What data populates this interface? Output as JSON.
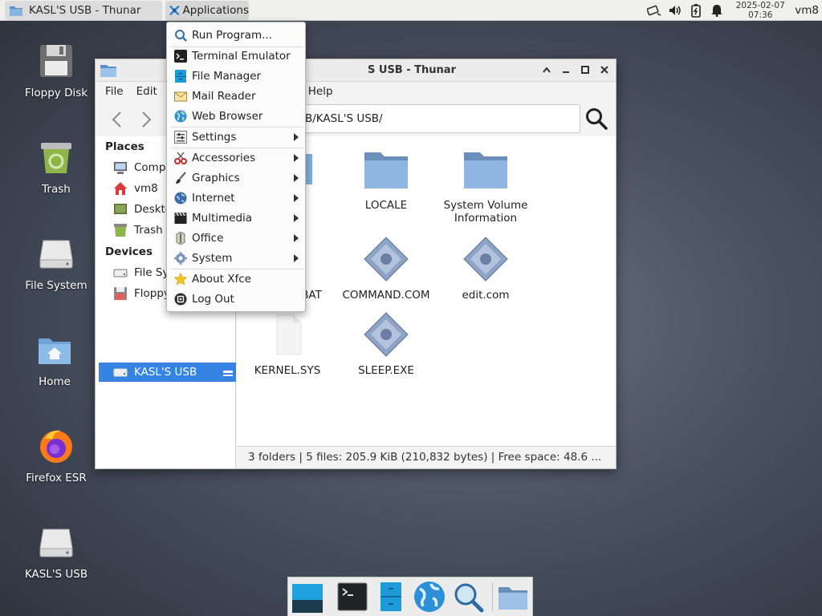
{
  "top_panel": {
    "task_title": "KASL'S USB - Thunar",
    "applications_label": "Applications",
    "clock_date": "2025-02-07",
    "clock_time": "07:36",
    "user": "vm8",
    "tray_icons": [
      "network-icon",
      "volume-icon",
      "battery-icon",
      "notification-bell-icon"
    ]
  },
  "desktop": {
    "icons": [
      {
        "label": "Floppy Disk",
        "icon": "floppy-disk-icon"
      },
      {
        "label": "Trash",
        "icon": "trash-icon"
      },
      {
        "label": "File System",
        "icon": "drive-icon"
      },
      {
        "label": "Home",
        "icon": "home-folder-icon"
      },
      {
        "label": "Firefox ESR",
        "icon": "firefox-icon"
      },
      {
        "label": "KASL'S USB",
        "icon": "usb-drive-icon"
      }
    ]
  },
  "window": {
    "title": "KASL'S USB - Thunar",
    "title_visible": "S USB - Thunar",
    "menu": [
      "File",
      "Edit",
      "Help"
    ],
    "path": "B/KASL'S USB/",
    "sidebar": {
      "places_header": "Places",
      "places": [
        "Compu",
        "vm8",
        "Deskto",
        "Trash"
      ],
      "devices_header": "Devices",
      "devices": [
        "File Sy",
        "Floppy",
        "KASL'S USB"
      ]
    },
    "files": [
      {
        "name": "LOCALE",
        "type": "folder"
      },
      {
        "name": "System Volume Information",
        "type": "folder"
      },
      {
        "name": "BAT",
        "type": "script"
      },
      {
        "name": "COMMAND.COM",
        "type": "executable"
      },
      {
        "name": "edit.com",
        "type": "executable"
      },
      {
        "name": "KERNEL.SYS",
        "type": "document"
      },
      {
        "name": "SLEEP.EXE",
        "type": "executable"
      }
    ],
    "status": "3 folders  |  5 files: 205.9 KiB (210,832 bytes)  |  Free space: 48.6 ..."
  },
  "app_menu": {
    "items": [
      {
        "label": "Run Program...",
        "icon": "magnifier-icon",
        "submenu": false
      },
      {
        "label": "Terminal Emulator",
        "icon": "terminal-icon",
        "submenu": false
      },
      {
        "label": "File Manager",
        "icon": "file-manager-icon",
        "submenu": false
      },
      {
        "label": "Mail Reader",
        "icon": "mail-icon",
        "submenu": false
      },
      {
        "label": "Web Browser",
        "icon": "globe-icon",
        "submenu": false
      },
      {
        "label": "Settings",
        "icon": "settings-icon",
        "submenu": true
      },
      {
        "label": "Accessories",
        "icon": "accessories-icon",
        "submenu": true
      },
      {
        "label": "Graphics",
        "icon": "brush-icon",
        "submenu": true
      },
      {
        "label": "Internet",
        "icon": "internet-icon",
        "submenu": true
      },
      {
        "label": "Multimedia",
        "icon": "clapperboard-icon",
        "submenu": true
      },
      {
        "label": "Office",
        "icon": "office-icon",
        "submenu": true
      },
      {
        "label": "System",
        "icon": "gear-icon",
        "submenu": true
      },
      {
        "label": "About Xfce",
        "icon": "star-icon",
        "submenu": false
      },
      {
        "label": "Log Out",
        "icon": "logout-icon",
        "submenu": false
      }
    ]
  },
  "dock": {
    "items": [
      "show-desktop-icon",
      "terminal-icon",
      "file-manager-icon",
      "web-browser-icon",
      "app-finder-icon",
      "folder-icon"
    ]
  }
}
